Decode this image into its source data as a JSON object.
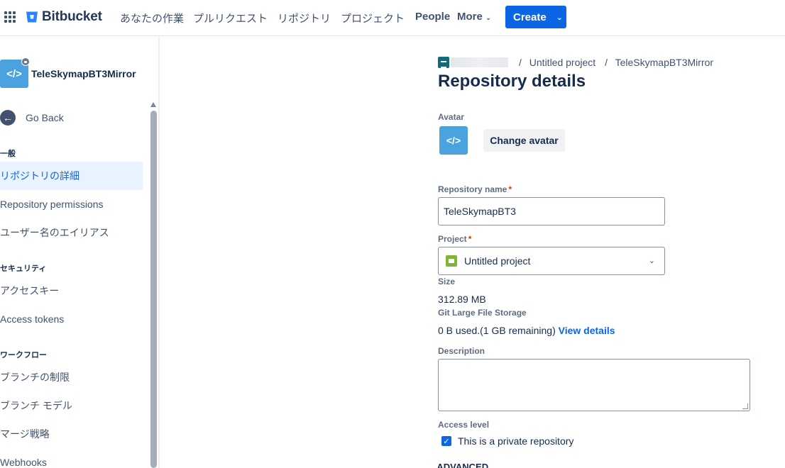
{
  "topnav": {
    "brand": "Bitbucket",
    "items": [
      "あなたの作業",
      "プルリクエスト",
      "リポジトリ",
      "プロジェクト",
      "People",
      "More"
    ],
    "create_label": "Create"
  },
  "sidebar": {
    "repo_name": "TeleSkymapBT3Mirror",
    "avatar_glyph": "</>",
    "go_back": "Go Back",
    "sections": [
      {
        "heading": "一般",
        "items": [
          "リポジトリの詳細",
          "Repository permissions",
          "ユーザー名のエイリアス"
        ]
      },
      {
        "heading": "セキュリティ",
        "items": [
          "アクセスキー",
          "Access tokens"
        ]
      },
      {
        "heading": "ワークフロー",
        "items": [
          "ブランチの制限",
          "ブランチ モデル",
          "マージ戦略",
          "Webhooks"
        ]
      }
    ],
    "active_item": "リポジトリの詳細"
  },
  "breadcrumb": {
    "project": "Untitled project",
    "repo": "TeleSkymapBT3Mirror",
    "separator": "/"
  },
  "main": {
    "title": "Repository details",
    "avatar_label": "Avatar",
    "avatar_glyph": "</>",
    "change_avatar": "Change avatar",
    "repo_name_label": "Repository name",
    "repo_name_value": "TeleSkymapBT3",
    "required_mark": "*",
    "project_label": "Project",
    "project_value": "Untitled project",
    "size_label": "Size",
    "size_value": "312.89 MB",
    "lfs_label": "Git Large File Storage",
    "lfs_value": "0 B used.(1 GB remaining)",
    "lfs_link": "View details",
    "description_label": "Description",
    "description_value": "",
    "access_label": "Access level",
    "private_checkbox": "This is a private repository",
    "private_checked": true,
    "advanced": "ADVANCED"
  },
  "colors": {
    "primary": "#0c66e4",
    "repo_avatar": "#4aa3df",
    "project_icon": "#7fb536",
    "active_bg": "#e9f2ff"
  }
}
